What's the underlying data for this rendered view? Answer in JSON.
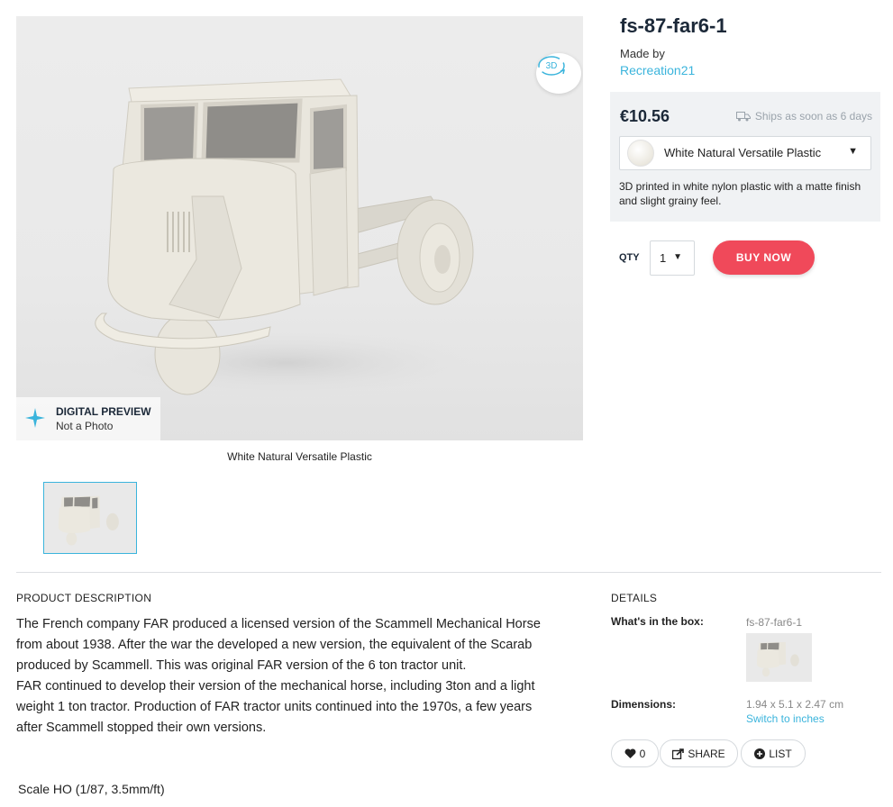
{
  "product": {
    "title": "fs-87-far6-1",
    "made_by_label": "Made by",
    "author": "Recreation21"
  },
  "viewer": {
    "btn_3d_label": "3D",
    "preview_title": "DIGITAL PREVIEW",
    "preview_sub": "Not a Photo",
    "caption": "White Natural Versatile Plastic"
  },
  "purchase": {
    "price": "€10.56",
    "ships": "Ships as soon as 6 days",
    "material": "White Natural Versatile Plastic",
    "material_desc": "3D printed in white nylon plastic with a matte finish and slight grainy feel.",
    "qty_label": "QTY",
    "qty_value": "1",
    "buy_label": "BUY NOW"
  },
  "description": {
    "heading": "PRODUCT DESCRIPTION",
    "p1": "The French company FAR produced a licensed version of the Scammell Mechanical Horse from about 1938. After the war the developed a new version, the equivalent of the Scarab produced by Scammell. This was original FAR version of the 6 ton tractor unit.",
    "p2": "FAR continued to develop their version of the mechanical horse, including 3ton and a light weight 1 ton tractor. Production of FAR tractor units continued into the 1970s, a few years after Scammell stopped their own versions.",
    "scale": "Scale HO  (1/87, 3.5mm/ft)"
  },
  "details": {
    "heading": "DETAILS",
    "box_label": "What's in the box:",
    "box_value": "fs-87-far6-1",
    "dim_label": "Dimensions:",
    "dim_value": "1.94 x 5.1 x 2.47 cm",
    "switch_label": "Switch to inches"
  },
  "actions": {
    "like_count": "0",
    "share_label": "SHARE",
    "list_label": "LIST"
  },
  "colors": {
    "accent": "#3ab4dc",
    "buy": "#f0495a",
    "title": "#1b2838"
  }
}
